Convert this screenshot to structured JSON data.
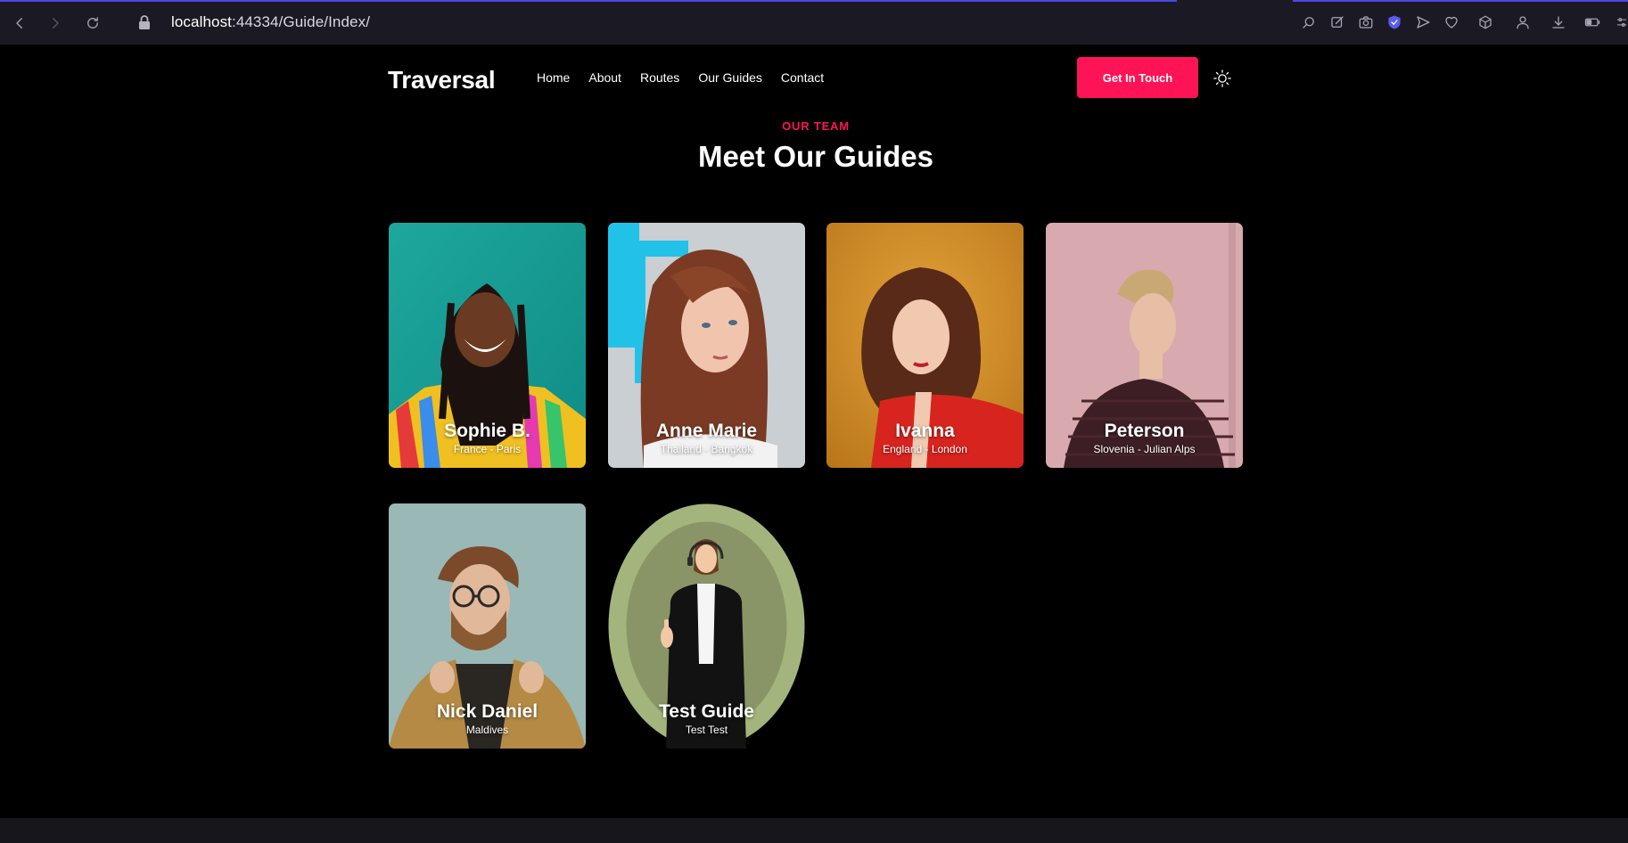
{
  "browser": {
    "url_host": "localhost",
    "url_path": ":44334/Guide/Index/",
    "nav_icons": [
      "back-icon",
      "forward-icon",
      "reload-icon"
    ],
    "toolbar_icons": [
      "search-icon",
      "edit-icon",
      "camera-icon",
      "shield-icon",
      "send-icon",
      "heart-icon",
      "cube-icon",
      "profile-icon",
      "download-icon",
      "battery-icon",
      "sliders-icon"
    ]
  },
  "site": {
    "logo": "Traversal",
    "nav": [
      "Home",
      "About",
      "Routes",
      "Our Guides",
      "Contact"
    ],
    "cta": "Get In Touch",
    "theme_icon": "sun-icon"
  },
  "section": {
    "eyebrow": "OUR TEAM",
    "title": "Meet Our Guides"
  },
  "guides": [
    {
      "name": "Sophie B.",
      "location": "France - Paris"
    },
    {
      "name": "Anne Marie",
      "location": "Thailand - Bangkok"
    },
    {
      "name": "Ivanna",
      "location": "England - London"
    },
    {
      "name": "Peterson",
      "location": "Slovenia - Julian Alps"
    },
    {
      "name": "Nick Daniel",
      "location": "Maldives"
    },
    {
      "name": "Test Guide",
      "location": "Test Test"
    }
  ],
  "colors": {
    "accent": "#fe1456",
    "background": "#000000",
    "browser_bar": "#1b1a24"
  }
}
